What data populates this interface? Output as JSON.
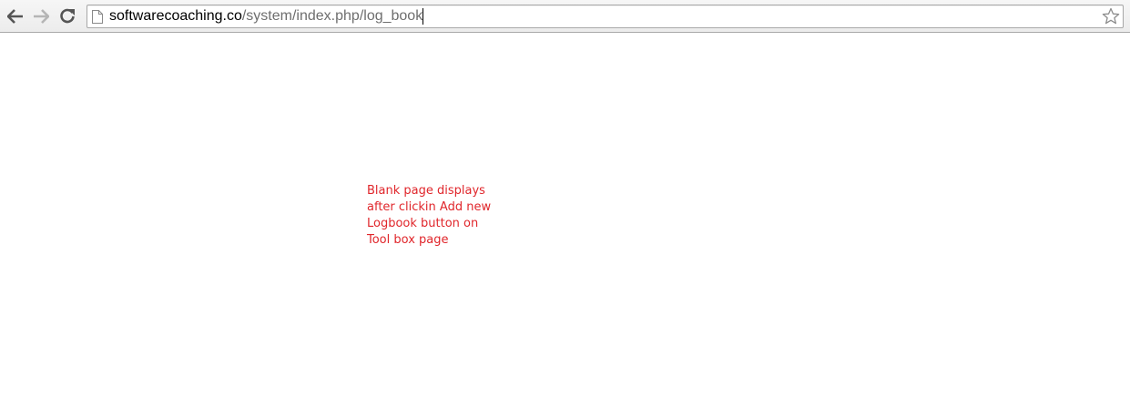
{
  "browser": {
    "url_host": "softwarecoaching.co",
    "url_path": "/system/index.php/log_book",
    "icons": {
      "back": "back-arrow-icon",
      "forward": "forward-arrow-icon",
      "reload": "reload-icon",
      "page": "page-icon",
      "bookmark": "star-icon"
    }
  },
  "annotation": {
    "color": "#e0262b",
    "lines": [
      "Blank page displays",
      "after clickin Add new",
      "Logbook button on",
      "Tool box page"
    ]
  }
}
